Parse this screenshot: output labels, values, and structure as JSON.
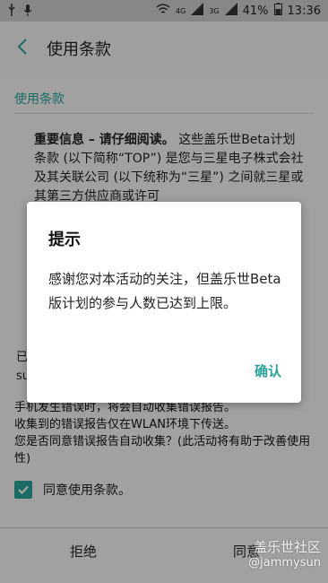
{
  "status_bar": {
    "left_icons": [
      "usb-icon",
      "microphone-icon"
    ],
    "right_icons": [
      "wifi-icon",
      "4g-signal-icon",
      "3g-signal-icon"
    ],
    "net1": "4G",
    "net2": "3G",
    "battery": "41%",
    "time": "13:36"
  },
  "appbar": {
    "title": "使用条款",
    "back_icon": "back-arrow-icon"
  },
  "content": {
    "subhead": "使用条款",
    "body_bold": "重要信息 – 请仔细阅读。",
    "body_rest": " 这些盖乐世Beta计划条款 (以下简称“TOP”) 是您与三星电子株式会社及其关联公司 (以下统称为“三星”) 之间就三星或其第三方供应商或许可",
    "side_frag_1": "已",
    "side_frag_2": "su",
    "bottom_lines": [
      "手机发生错误时，将会自动收集错误报告。",
      "收集到的错误报告仅在WLAN环境下传送。",
      "您是否同意错误报告自动收集？(此活动将有助于改善使用性)"
    ],
    "agree_checkbox_label": "同意使用条款。",
    "agree_checked": true
  },
  "buttons": {
    "reject": "拒绝",
    "agree": "同意"
  },
  "dialog": {
    "title": "提示",
    "message": "感谢您对本活动的关注，但盖乐世Beta 版计划的参与人数已达到上限。",
    "confirm": "确认"
  },
  "watermark": {
    "line1": "盖乐世社区",
    "line2": "@jammysun"
  },
  "colors": {
    "accent": "#2aa49a"
  }
}
